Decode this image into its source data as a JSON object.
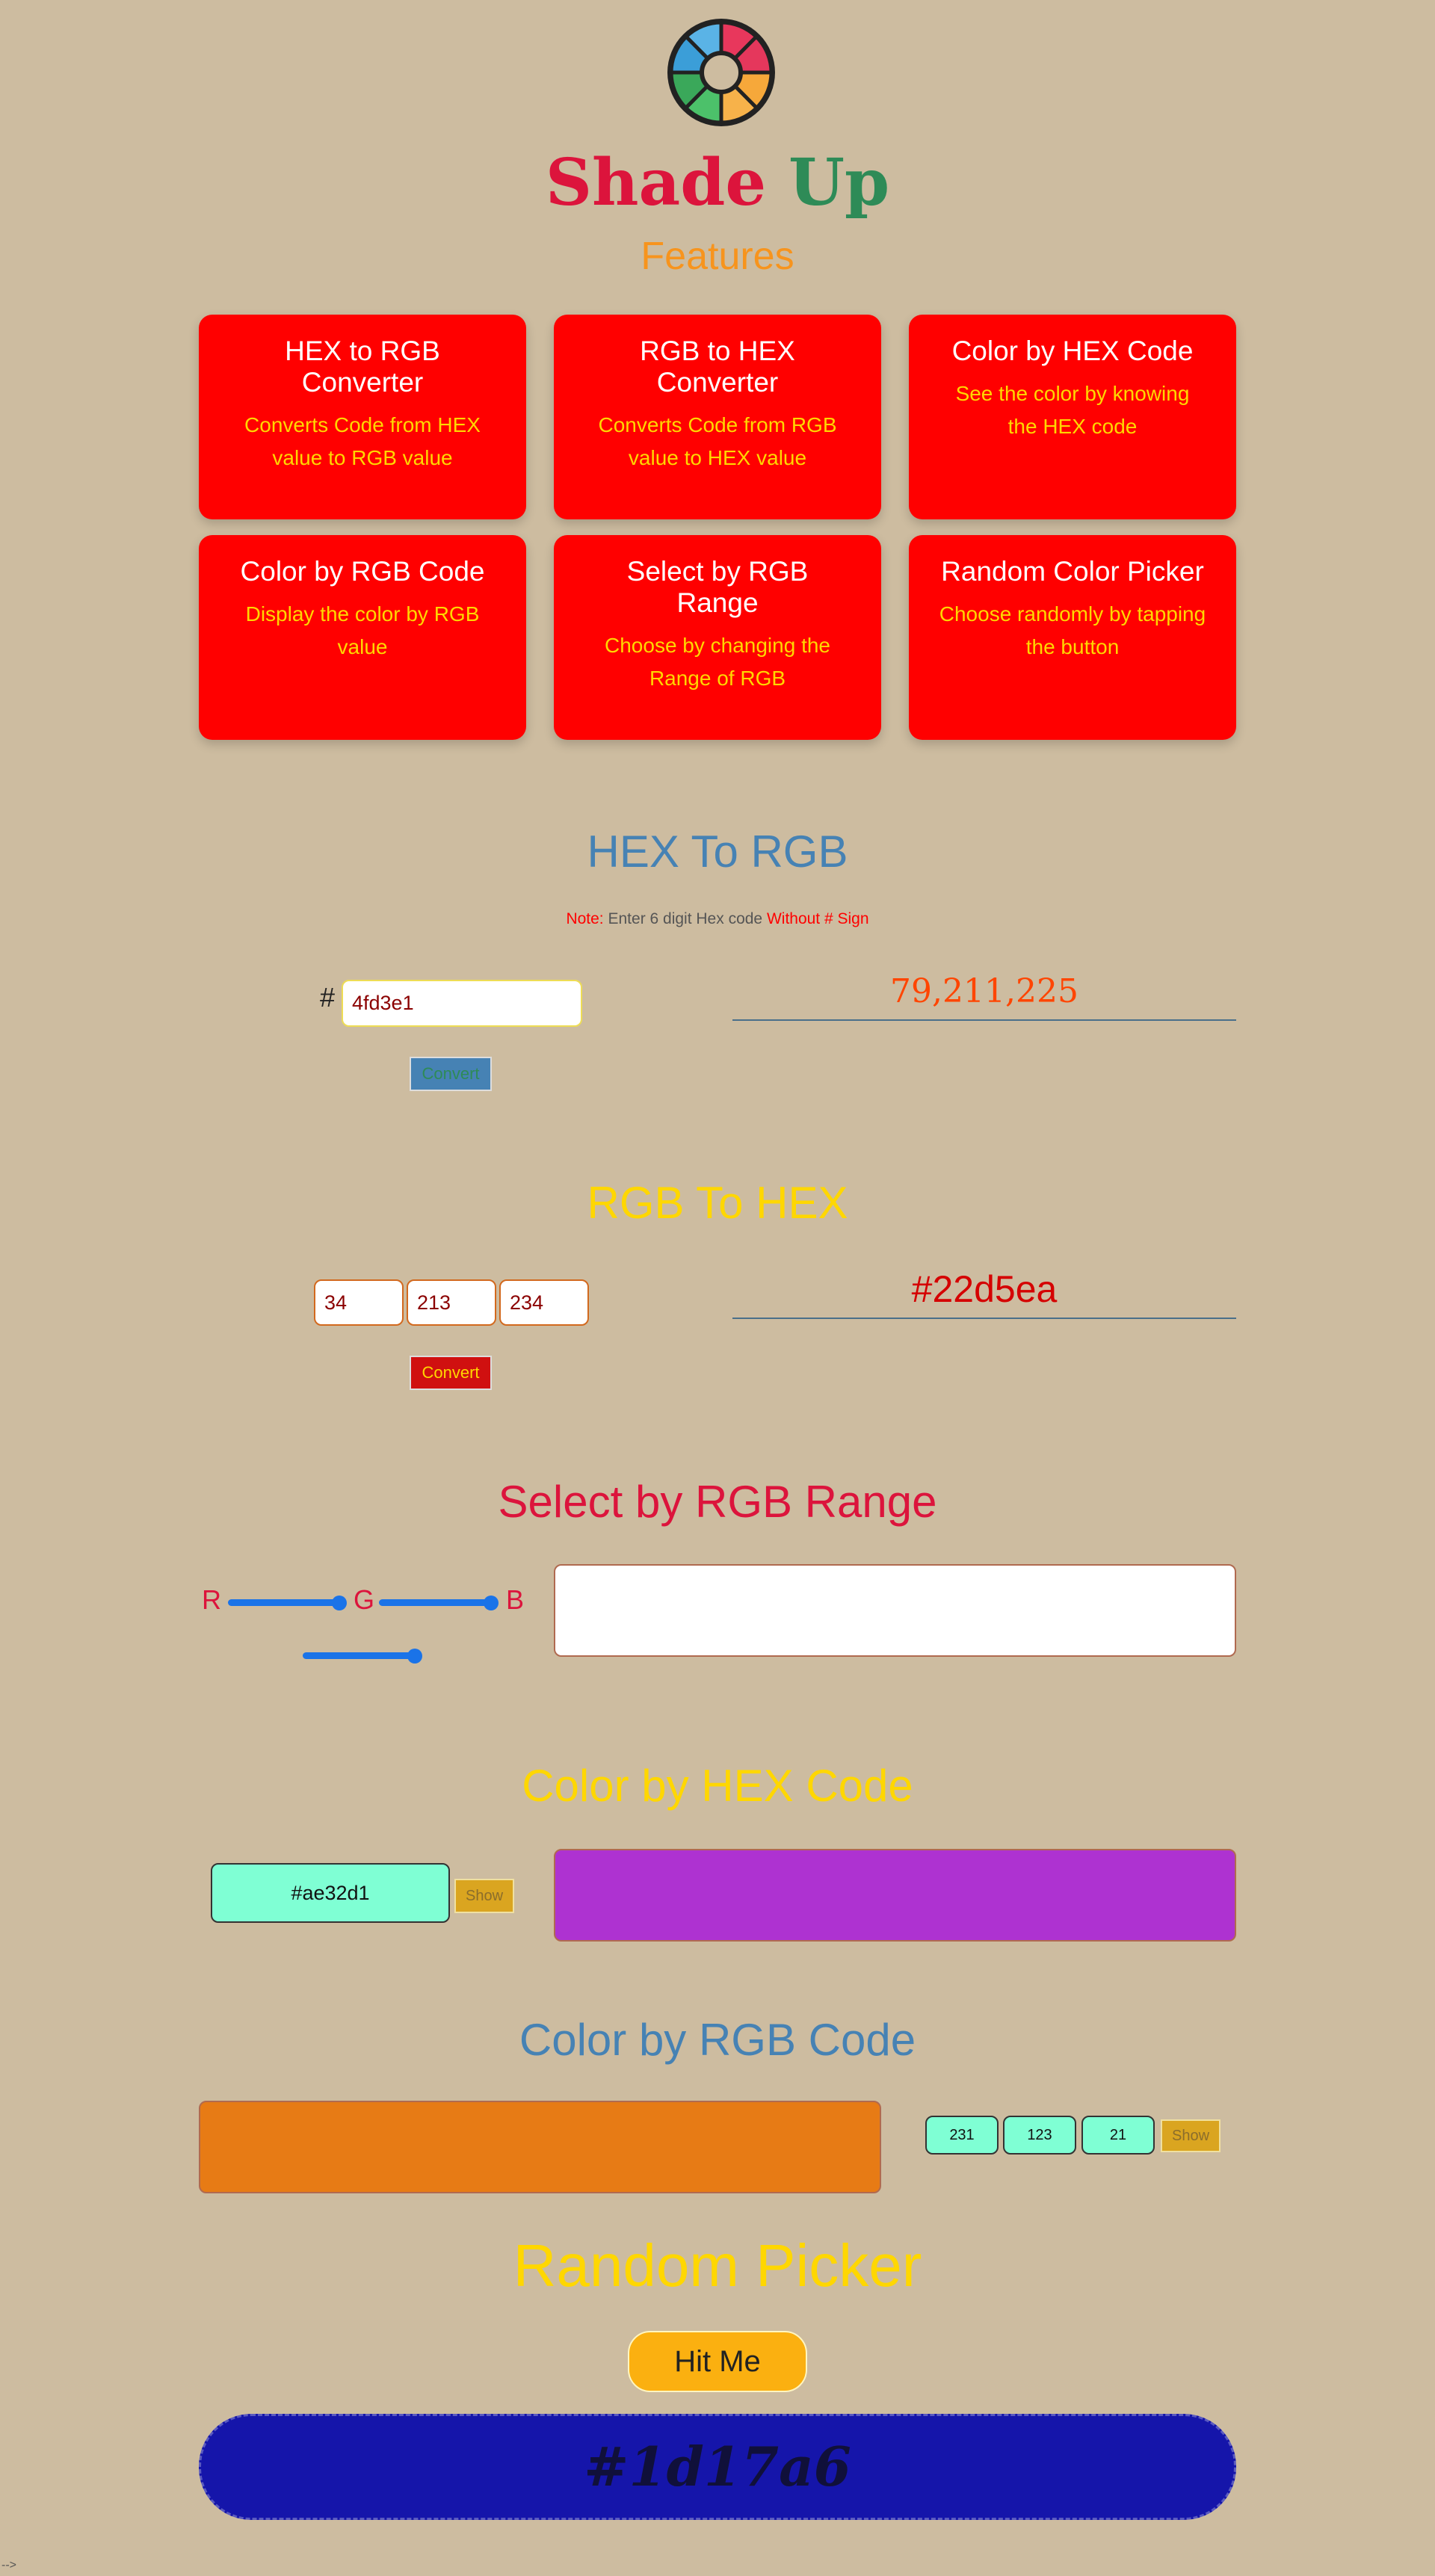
{
  "brand": {
    "word1": "Shade",
    "word2": "Up"
  },
  "features": {
    "title": "Features",
    "cards": [
      {
        "title": "HEX to RGB Converter",
        "desc": "Converts Code from HEX value to RGB value"
      },
      {
        "title": "RGB to HEX Converter",
        "desc": "Converts Code from RGB value to HEX value"
      },
      {
        "title": "Color by HEX Code",
        "desc": "See the color by knowing the HEX code"
      },
      {
        "title": "Color by RGB Code",
        "desc": "Display the color by RGB value"
      },
      {
        "title": "Select by RGB Range",
        "desc": "Choose by changing the Range of RGB"
      },
      {
        "title": "Random Color Picker",
        "desc": "Choose randomly by tapping the button"
      }
    ]
  },
  "hex_to_rgb": {
    "title": "HEX To RGB",
    "note_label": "Note:",
    "note_text": " Enter 6 digit Hex code ",
    "note_emph": "Without # Sign",
    "hash": "#",
    "input_value": "4fd3e1",
    "convert_label": "Convert",
    "result": "79,211,225"
  },
  "rgb_to_hex": {
    "title": "RGB To HEX",
    "r": "34",
    "g": "213",
    "b": "234",
    "convert_label": "Convert",
    "result": "#22d5ea"
  },
  "rgb_range": {
    "title": "Select by RGB Range",
    "labels": {
      "r": "R",
      "g": "G",
      "b": "B"
    },
    "values": {
      "r": 255,
      "g": 255,
      "b": 255
    },
    "preview_color": "#ffffff"
  },
  "color_by_hex": {
    "title": "Color by HEX Code",
    "input_value": "#ae32d1",
    "show_label": "Show",
    "preview_color": "#ae32d1"
  },
  "color_by_rgb": {
    "title": "Color by RGB Code",
    "r": "231",
    "g": "123",
    "b": "21",
    "show_label": "Show",
    "preview_color": "#e77b15"
  },
  "random_picker": {
    "title": "Random Picker",
    "button_label": "Hit Me",
    "hex": "#1d17a6",
    "preview_color": "#1515aa"
  },
  "footer": {
    "text": "-->"
  },
  "colors": {
    "background": "#cdbca0",
    "card": "#ff0000",
    "title_blue": "#4682b4",
    "title_yellow": "#ffd700",
    "title_crimson": "#dc143c"
  }
}
